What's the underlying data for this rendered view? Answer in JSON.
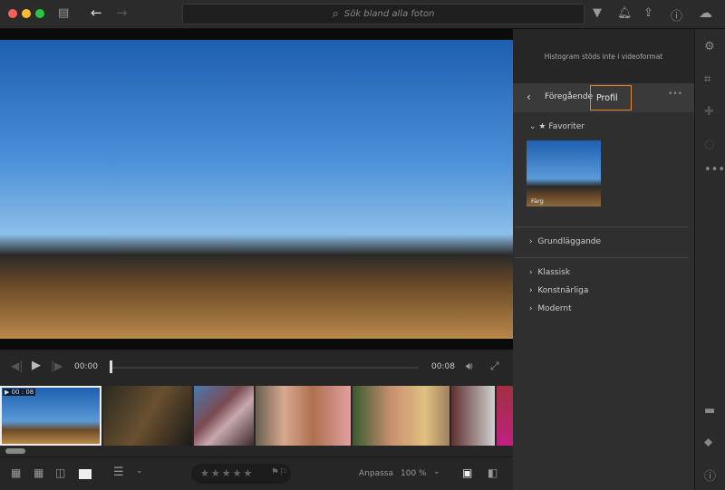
{
  "toolbar": {
    "search_placeholder": "Sök bland alla foton"
  },
  "player": {
    "current_time": "00:00",
    "duration": "00:08",
    "progress": 0
  },
  "filmstrip": {
    "badge": "▶ 00 : 08"
  },
  "bottom": {
    "zoom_mode": "Anpassa",
    "zoom_level": "100 %",
    "rating": 0
  },
  "panel": {
    "histogram_msg": "Histogram stöds inte i videoformat",
    "back_label": "Föregående",
    "title": "Profil",
    "favorites": "Favoriter",
    "favorite_thumb_label": "Färg",
    "groups": [
      "Grundläggande",
      "Klassisk",
      "Konstnärliga",
      "Modernt"
    ]
  }
}
